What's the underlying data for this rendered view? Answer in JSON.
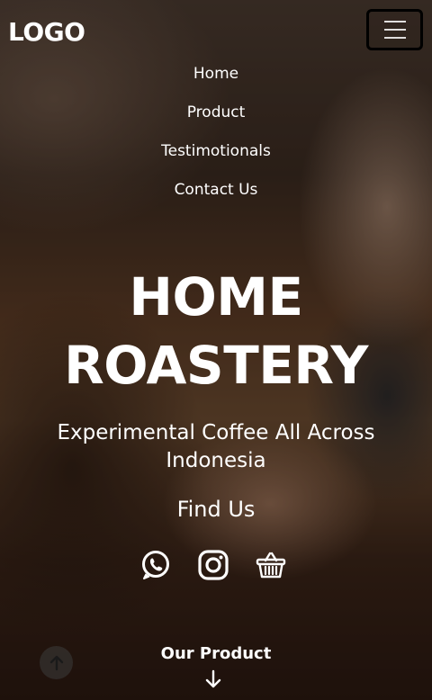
{
  "header": {
    "logo": "LOGO",
    "menu_icon": "hamburger-menu-icon"
  },
  "nav": {
    "items": [
      {
        "label": "Home"
      },
      {
        "label": "Product"
      },
      {
        "label": "Testimotionals"
      },
      {
        "label": "Contact Us"
      }
    ]
  },
  "hero": {
    "title_line1": "HOME",
    "title_line2": "ROASTERY",
    "subtitle": "Experimental Coffee All Across Indonesia",
    "find_us": "Find Us"
  },
  "socials": {
    "icons": [
      "whatsapp-icon",
      "instagram-icon",
      "basket-icon"
    ]
  },
  "footer": {
    "our_product": "Our Product",
    "arrow_icon": "arrow-down-icon",
    "scroll_top_icon": "arrow-up-icon"
  },
  "colors": {
    "text": "#ffffff",
    "hamburger_border": "#000000"
  }
}
